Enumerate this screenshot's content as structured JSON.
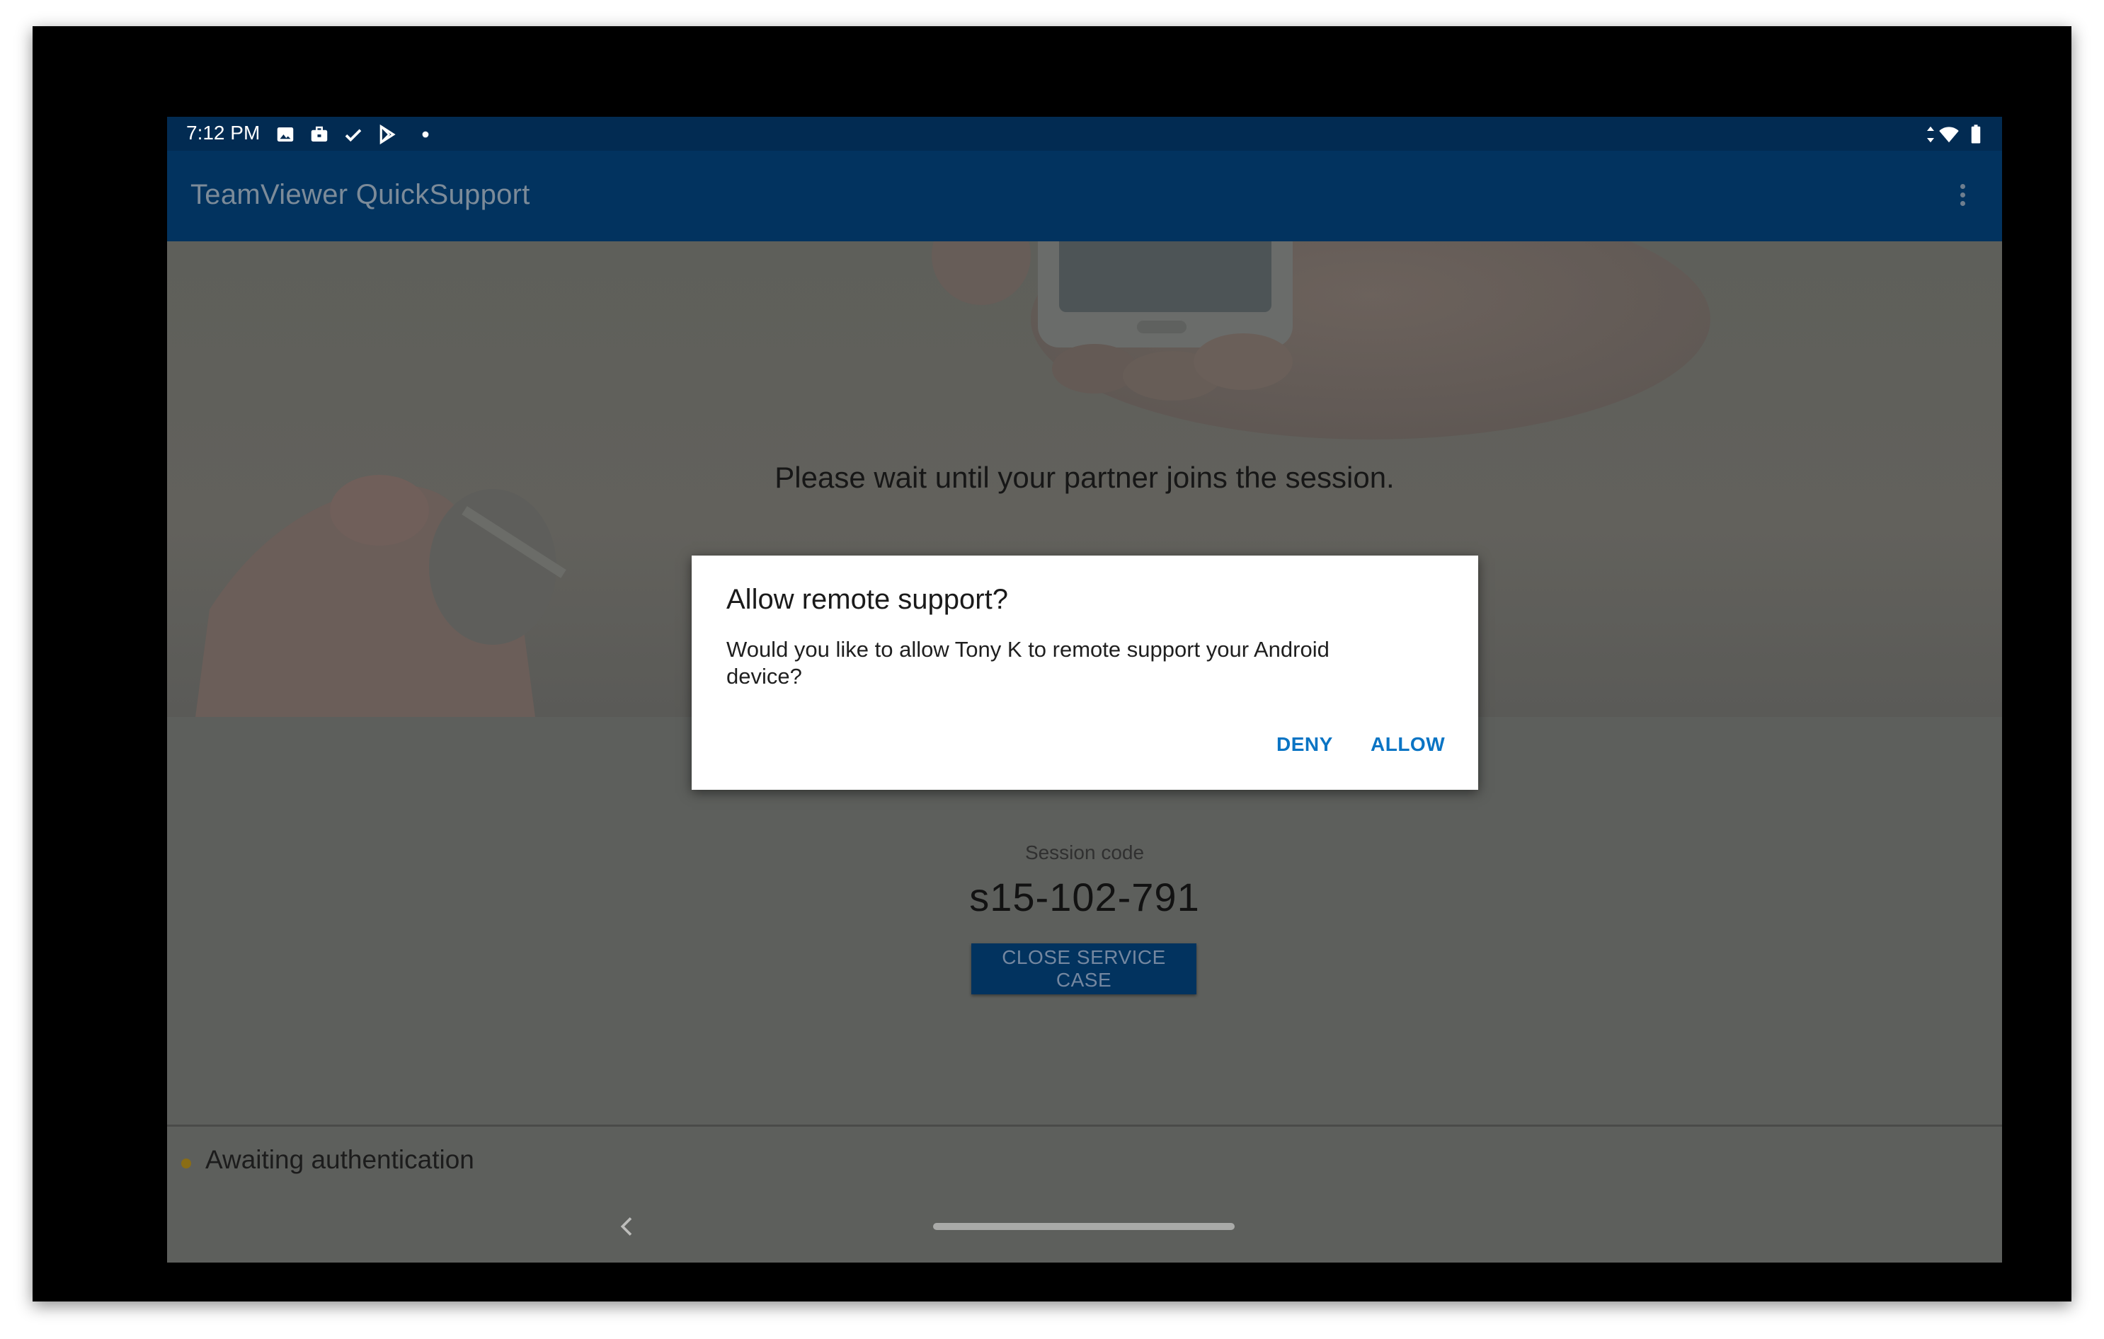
{
  "status_bar": {
    "time": "7:12 PM",
    "left_icons": [
      "image-icon",
      "briefcase-icon",
      "check-icon",
      "play-store-icon",
      "dot-icon"
    ],
    "right_icons": [
      "data-arrows-icon",
      "wifi-icon",
      "battery-icon"
    ]
  },
  "app_bar": {
    "title": "TeamViewer QuickSupport",
    "menu_icon": "more-vert-icon"
  },
  "hero": {
    "wait_message": "Please wait until your partner joins the session."
  },
  "session": {
    "label": "Session code",
    "code": "s15-102-791",
    "close_button_label": "CLOSE SERVICE CASE"
  },
  "footer": {
    "status_text": "Awaiting authentication",
    "status_color": "#8a6d15"
  },
  "dialog": {
    "title": "Allow remote support?",
    "message": "Would you like to allow Tony K to remote support your Android device?",
    "deny_label": "DENY",
    "allow_label": "ALLOW",
    "accent_color": "#0a74c4"
  },
  "nav": {
    "back_icon": "chevron-left-icon",
    "home_icon": "home-handle-icon"
  },
  "colors": {
    "app_bar": "#02335f",
    "status_bar": "#022b52",
    "scrim_background": "#5d5f5c"
  }
}
